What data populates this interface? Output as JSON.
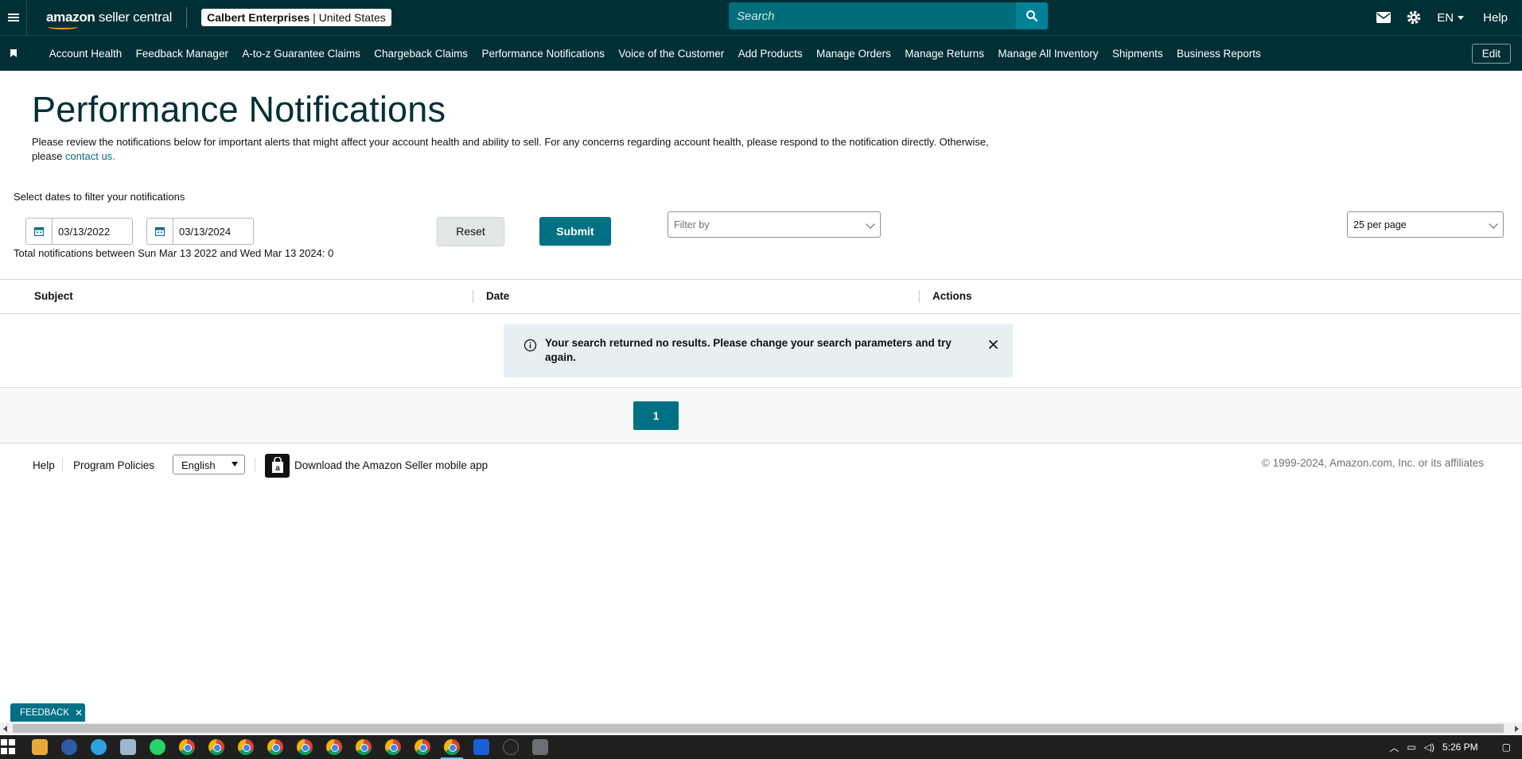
{
  "topbar": {
    "logo_prefix": "amazon",
    "logo_suffix": " seller central",
    "store_name": "Calbert Enterprises",
    "store_region": " | United States",
    "search_placeholder": "Search",
    "language": "EN",
    "help": "Help"
  },
  "nav": {
    "items": [
      "Account Health",
      "Feedback Manager",
      "A-to-z Guarantee Claims",
      "Chargeback Claims",
      "Performance Notifications",
      "Voice of the Customer",
      "Add Products",
      "Manage Orders",
      "Manage Returns",
      "Manage All Inventory",
      "Shipments",
      "Business Reports"
    ],
    "edit": "Edit"
  },
  "page": {
    "title": "Performance Notifications",
    "intro_text": "Please review the notifications below for important alerts that might affect your account health and ability to sell. For any concerns regarding account health, please respond to the notification directly. Otherwise, please ",
    "intro_link": "contact us."
  },
  "filters": {
    "label": "Select dates to filter your notifications",
    "start_date": "03/13/2022",
    "end_date": "03/13/2024",
    "reset": "Reset",
    "submit": "Submit",
    "filter_by": "Filter by",
    "per_page": "25 per page",
    "total_text": "Total notifications between Sun Mar 13 2022 and Wed Mar 13 2024: 0"
  },
  "table": {
    "columns": [
      "Subject",
      "Date",
      "Actions"
    ],
    "empty_message": "Your search returned no results. Please change your search parameters and try again."
  },
  "pagination": {
    "current_page": "1"
  },
  "footer": {
    "help": "Help",
    "program_policies": "Program Policies",
    "language": "English",
    "app_download": "Download the Amazon Seller mobile app",
    "copyright": "© 1999-2024, Amazon.com, Inc. or its affiliates"
  },
  "feedback": {
    "label": "FEEDBACK",
    "close": "✕"
  },
  "taskbar": {
    "time": "5:26 PM"
  },
  "colors": {
    "header_bg": "#002f36",
    "accent": "#007185",
    "alert_bg": "#e6f0f2"
  }
}
